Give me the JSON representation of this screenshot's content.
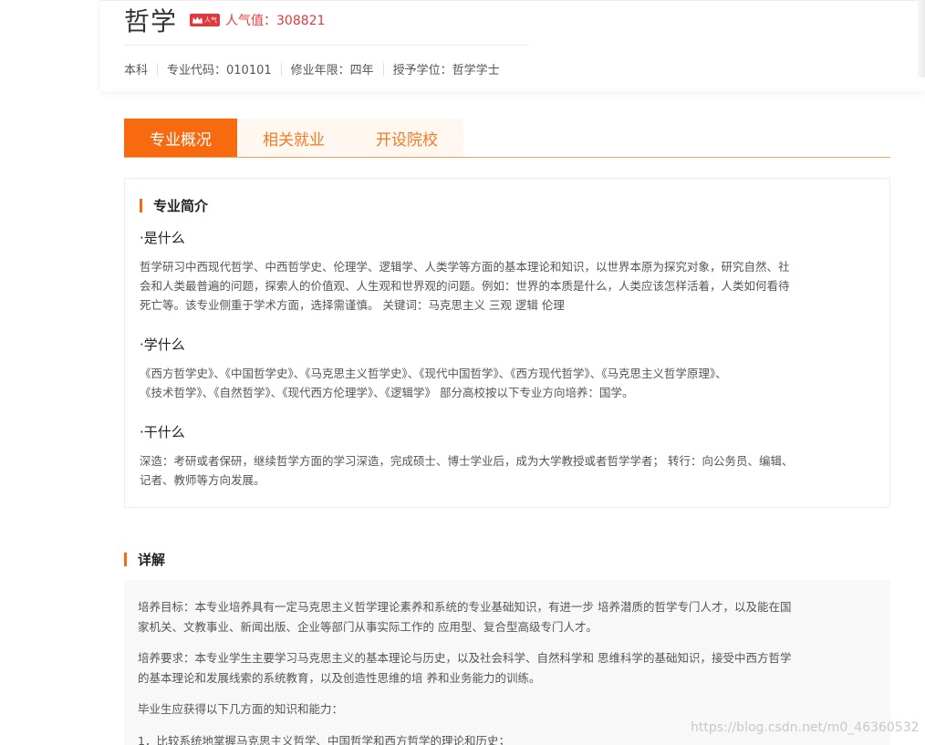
{
  "major": {
    "name": "哲学",
    "badge": "人气",
    "popularity": "人气值：308821"
  },
  "meta": {
    "level": "本科",
    "code": "专业代码：010101",
    "duration": "修业年限：四年",
    "degree": "授予学位：哲学学士"
  },
  "tabs": [
    {
      "label": "专业概况"
    },
    {
      "label": "相关就业"
    },
    {
      "label": "开设院校"
    }
  ],
  "intro": {
    "title": "专业简介",
    "what_is_head": "·是什么",
    "what_is_line1": "哲学研习中西现代哲学、中西哲学史、伦理学、逻辑学、人类学等方面的基本理论和知识，以世界本原为探究对象，研究自然、社",
    "what_is_line2": "会和人类最普遍的问题，探索人的价值观、人生观和世界观的问题。例如：世界的本质是什么，人类应该怎样活着，人类如何看待",
    "what_is_line3": "死亡等。该专业侧重于学术方面，选择需谨慎。 关键词：马克思主义 三观 逻辑 伦理",
    "study_head": "·学什么",
    "study_line1": "《西方哲学史》、《中国哲学史》、《马克思主义哲学史》、《现代中国哲学》、《西方现代哲学》、《马克思主义哲学原理》、",
    "study_line2": "《技术哲学》、《自然哲学》、《现代西方伦理学》、《逻辑学》 部分高校按以下专业方向培养：国学。",
    "work_head": "·干什么",
    "work_line1": "深造：考研或者保研，继续哲学方面的学习深造，完成硕士、博士学业后，成为大学教授或者哲学学者； 转行：向公务员、编辑、",
    "work_line2": "记者、教师等方向发展。"
  },
  "detail": {
    "title": "详解",
    "goal_line1": "培养目标：本专业培养具有一定马克思主义哲学理论素养和系统的专业基础知识，有进一步 培养潜质的哲学专门人才，以及能在国",
    "goal_line2": "家机关、文教事业、新闻出版、企业等部门从事实际工作的 应用型、复合型高级专门人才。",
    "req_line1": "培养要求：本专业学生主要学习马克思主义的基本理论与历史，以及社会科学、自然科学和 思维科学的基础知识，接受中西方哲学",
    "req_line2": "的基本理论和发展线索的系统教育，以及创造性思维的培 养和业务能力的训练。",
    "ability": "毕业生应获得以下几方面的知识和能力：",
    "item1": "1．比较系统地掌握马克思主义哲学、中国哲学和西方哲学的理论和历史；"
  },
  "watermark": "https://blog.csdn.net/m0_46360532",
  "colors": {
    "accent": "#f86a10",
    "hot": "#e4393c"
  }
}
